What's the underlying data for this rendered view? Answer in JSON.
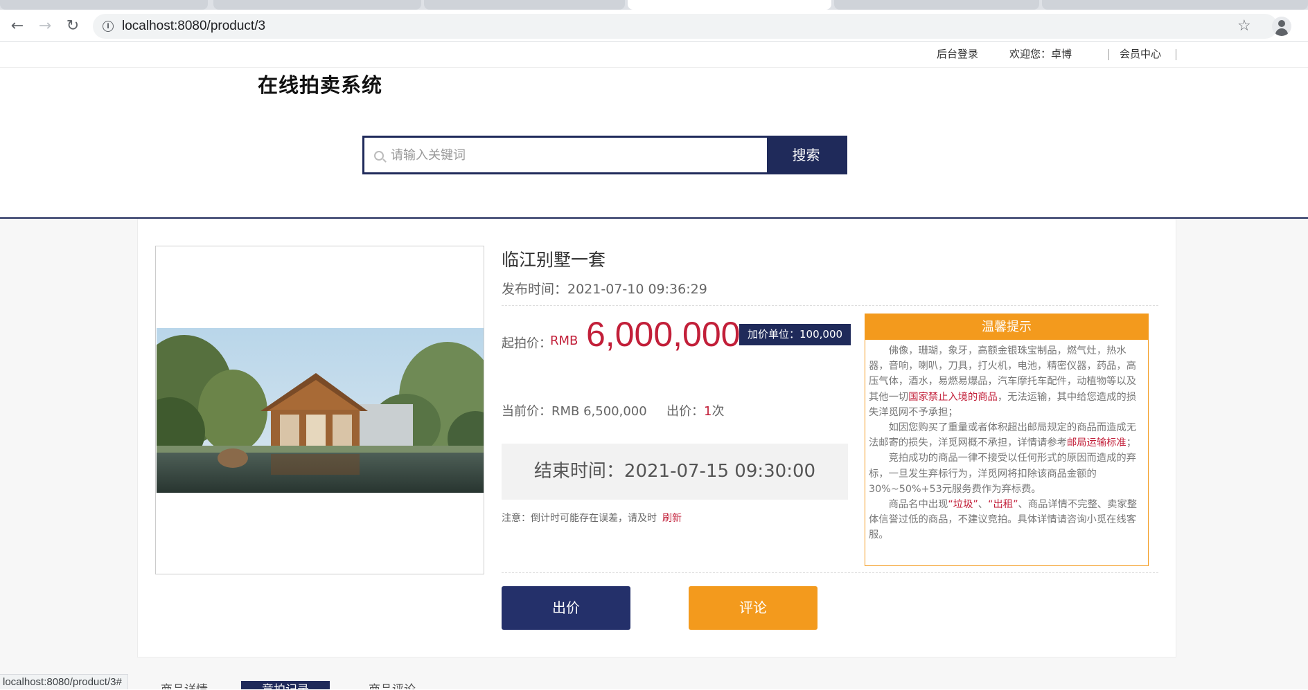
{
  "browser": {
    "url": "localhost:8080/product/3",
    "status_url": "localhost:8080/product/3#"
  },
  "topbar": {
    "admin_login": "后台登录",
    "welcome": "欢迎您：卓博",
    "member_center": "会员中心"
  },
  "site": {
    "title": "在线拍卖系统"
  },
  "search": {
    "placeholder": "请输入关键词",
    "button": "搜索"
  },
  "product": {
    "name": "临江别墅一套",
    "publish_time": "发布时间：2021-07-10 09:36:29",
    "start_price_label": "起拍价：",
    "start_price_currency": "RMB",
    "start_price": "6,000,000",
    "increment": "加价单位：100,000",
    "current_price": "当前价：RMB 6,500,000",
    "bid_label": "出价：",
    "bid_count": "1",
    "bid_unit": "次",
    "end_time": "结束时间：2021-07-15 09:30:00",
    "note": "注意：倒计时可能存在误差，请及时",
    "refresh": "刷新"
  },
  "actions": {
    "bid": "出价",
    "comment": "评论"
  },
  "tips": {
    "title": "温馨提示",
    "p1_a": "佛像，珊瑚，象牙，高额金银珠宝制品，燃气灶，热水器，音响，喇叭，刀具，打火机，电池，精密仪器，药品，高压气体，酒水，易燃易爆品，汽车摩托车配件，动植物等以及其他一切",
    "p1_hl": "国家禁止入境的商品",
    "p1_b": "，无法运输，其中给您造成的损失洋觅网不予承担；",
    "p2_a": "如因您购买了重量或者体积超出邮局规定的商品而造成无法邮寄的损失，洋觅网概不承担，详情请参考",
    "p2_hl": "邮局运输标准",
    "p2_b": "；",
    "p3": "竞拍成功的商品一律不接受以任何形式的原因而造成的弃标，一旦发生弃标行为，洋觅网将扣除该商品金额的30%~50%+53元服务费作为弃标费。",
    "p4_a": "商品名中出现",
    "p4_hl1": "“垃圾”",
    "p4_sep": "、",
    "p4_hl2": "“出租”",
    "p4_b": "、商品详情不完整、卖家整体信誉过低的商品，不建议竞拍。具体详情请咨询小觅在线客服。"
  },
  "tabs": [
    "商品详情",
    "竞拍记录",
    "商品评论"
  ]
}
